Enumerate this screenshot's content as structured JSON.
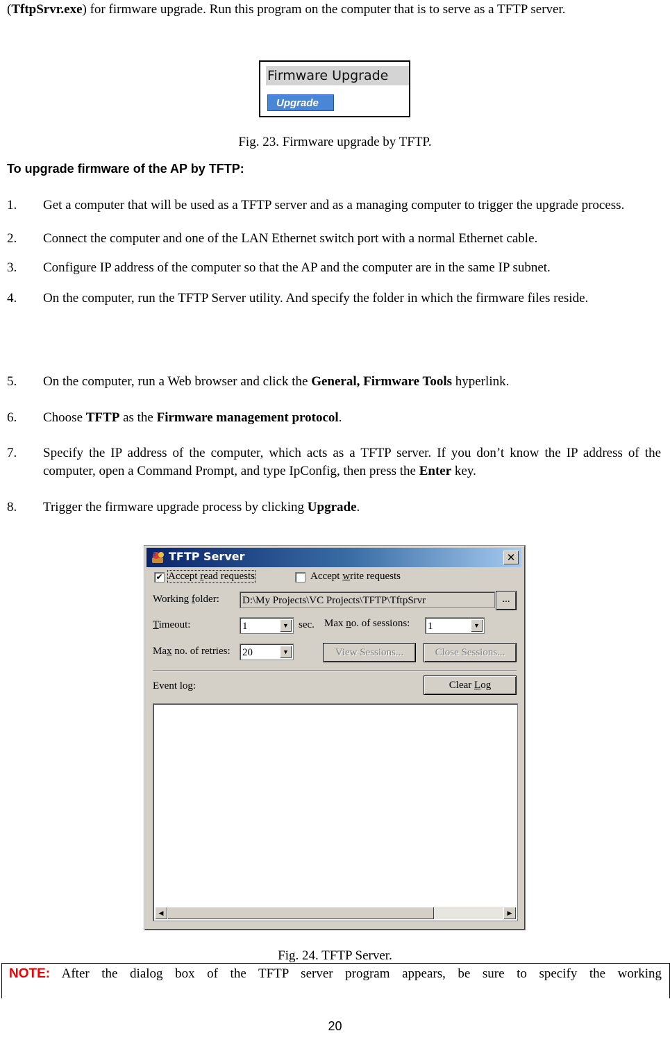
{
  "intro": {
    "exe_name": "TftpSrvr.exe",
    "text_after": ") for firmware upgrade. Run this program on the computer that is to serve as a TFTP server.",
    "open_paren": "("
  },
  "fig23": {
    "panel_title": "Firmware Upgrade",
    "button_label": "Upgrade",
    "caption": "Fig. 23. Firmware upgrade by TFTP."
  },
  "section_heading": "To upgrade firmware of the AP by TFTP:",
  "steps": [
    {
      "num": "1.",
      "parts": [
        {
          "t": "Get a computer that will be used as a TFTP server and as a managing computer to trigger the upgrade process."
        }
      ]
    },
    {
      "num": "2.",
      "parts": [
        {
          "t": "Connect the computer and one of the LAN Ethernet switch port with a normal Ethernet cable."
        }
      ]
    },
    {
      "num": "3.",
      "parts": [
        {
          "t": "Configure IP address of the computer so that the AP and the computer are in the same IP subnet."
        }
      ]
    },
    {
      "num": "4.",
      "parts": [
        {
          "t": "On the computer, run the TFTP Server utility. And specify the folder in which the firmware files reside."
        }
      ]
    },
    {
      "num": "5.",
      "parts": [
        {
          "t": "On the computer, run a Web browser and click the "
        },
        {
          "t": "General, Firmware Tools",
          "b": true
        },
        {
          "t": " hyperlink."
        }
      ]
    },
    {
      "num": "6.",
      "parts": [
        {
          "t": "Choose "
        },
        {
          "t": "TFTP",
          "b": true
        },
        {
          "t": " as the "
        },
        {
          "t": "Firmware management protocol",
          "b": true
        },
        {
          "t": "."
        }
      ]
    },
    {
      "num": "7.",
      "parts": [
        {
          "t": "Specify the IP address of the computer, which acts as a TFTP server. If you don’t know the IP address of the computer, open a Command Prompt, and type IpConfig, then press the "
        },
        {
          "t": "Enter",
          "b": true
        },
        {
          "t": " key."
        }
      ]
    },
    {
      "num": "8.",
      "parts": [
        {
          "t": "Trigger the firmware upgrade process by clicking "
        },
        {
          "t": "Upgrade",
          "b": true
        },
        {
          "t": "."
        }
      ]
    }
  ],
  "tftp_dialog": {
    "title": "TFTP Server",
    "close_glyph": "✕",
    "accept_read": {
      "label": "Accept read requests",
      "checked": true,
      "check_glyph": "✔"
    },
    "accept_write": {
      "label": "Accept write requests",
      "checked": false
    },
    "working_folder_label": "Working folder:",
    "working_folder_value": "D:\\My Projects\\VC Projects\\TFTP\\TftpSrvr",
    "browse_label": "...",
    "timeout_label": "Timeout:",
    "timeout_value": "1",
    "timeout_unit": "sec.",
    "max_sessions_label": "Max no. of sessions:",
    "max_sessions_value": "1",
    "max_retries_label": "Max no. of retries:",
    "max_retries_value": "20",
    "view_sessions_label": "View Sessions...",
    "close_sessions_label": "Close Sessions...",
    "event_log_label": "Event log:",
    "clear_log_label": "Clear Log",
    "arrow_down": "▼",
    "arrow_left": "◀",
    "arrow_right": "▶"
  },
  "fig24_caption": "Fig. 24. TFTP Server.",
  "note": {
    "label": "NOTE:",
    "text": " After the dialog box of the TFTP server program appears, be sure to specify the working"
  },
  "page_number": "20"
}
